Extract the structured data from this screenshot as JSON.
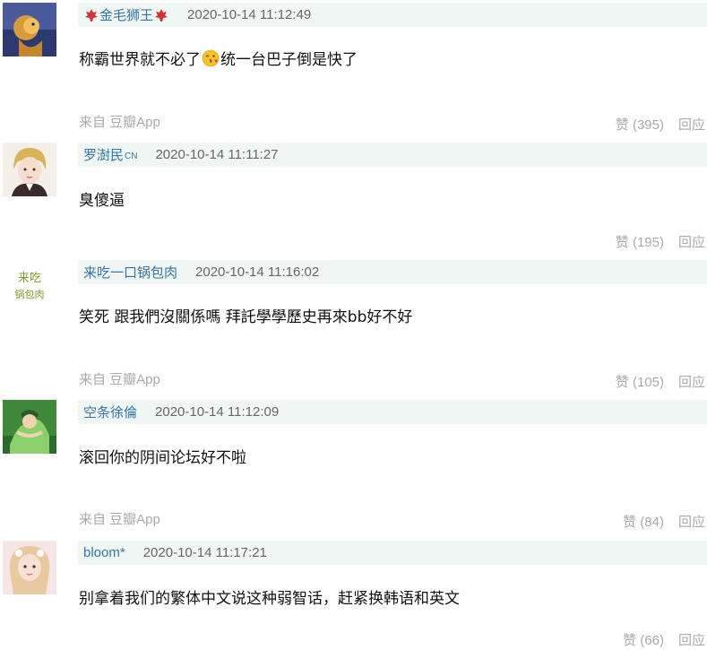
{
  "comments": [
    {
      "author": "金毛狮王",
      "author_badge": "",
      "time": "2020-10-14 11:12:49",
      "text_before": "称霸世界就不必了",
      "text_after": "统一台巴子倒是快了",
      "source": "来自 豆瓣App",
      "like": "赞 (395)",
      "reply": "回应"
    },
    {
      "author": "罗澍民",
      "author_badge": "CN",
      "time": "2020-10-14 11:11:27",
      "text": "臭傻逼",
      "source": "",
      "like": "赞 (195)",
      "reply": "回应"
    },
    {
      "author": "来吃一口锅包肉",
      "author_badge": "",
      "time": "2020-10-14 11:16:02",
      "text": "笑死 跟我們沒關係嗎 拜託學學歷史再來bb好不好",
      "source": "来自 豆瓣App",
      "like": "赞 (105)",
      "reply": "回应",
      "avatar_text": "来吃锅包肉"
    },
    {
      "author": "空条徐倫",
      "author_badge": "",
      "time": "2020-10-14 11:12:09",
      "text": "滚回你的阴间论坛好不啦",
      "source": "来自 豆瓣App",
      "like": "赞 (84)",
      "reply": "回应"
    },
    {
      "author": "bloom*",
      "author_badge": "",
      "time": "2020-10-14 11:17:21",
      "text": "别拿着我们的繁体中文说这种弱智话，赶紧换韩语和英文",
      "source": "",
      "like": "赞 (66)",
      "reply": "回应"
    }
  ],
  "colors": {
    "author": "#3377aa",
    "meta_bg": "#f0f6f3",
    "muted": "#aaaaaa"
  }
}
